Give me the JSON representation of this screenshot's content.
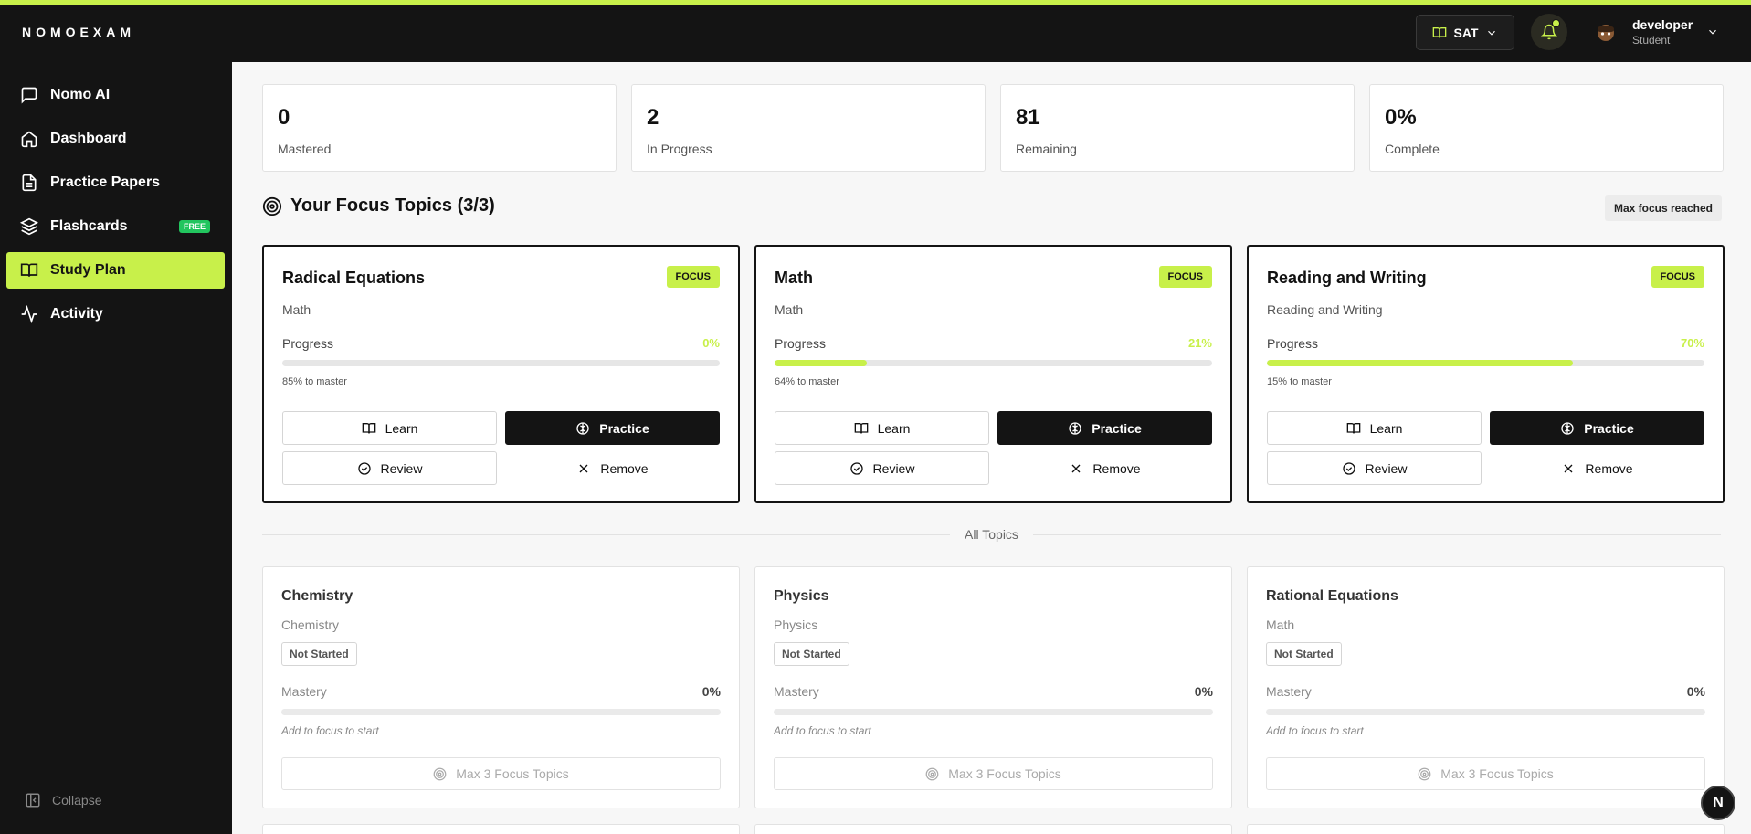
{
  "app": {
    "logo": "NOMOEXAM"
  },
  "header": {
    "exam": "SAT",
    "user": {
      "name": "developer",
      "role": "Student"
    }
  },
  "sidebar": {
    "items": [
      {
        "label": "Nomo AI",
        "icon": "chat-icon"
      },
      {
        "label": "Dashboard",
        "icon": "home-icon"
      },
      {
        "label": "Practice Papers",
        "icon": "document-icon"
      },
      {
        "label": "Flashcards",
        "icon": "layers-icon",
        "badge": "FREE"
      },
      {
        "label": "Study Plan",
        "icon": "book-icon",
        "active": true
      },
      {
        "label": "Activity",
        "icon": "activity-icon"
      }
    ],
    "collapse_label": "Collapse"
  },
  "stats": [
    {
      "value": "0",
      "label": "Mastered"
    },
    {
      "value": "2",
      "label": "In Progress"
    },
    {
      "value": "81",
      "label": "Remaining"
    },
    {
      "value": "0%",
      "label": "Complete"
    }
  ],
  "focus": {
    "heading": "Your Focus Topics (3/3)",
    "max_reached": "Max focus reached",
    "badge": "FOCUS",
    "progress_label": "Progress",
    "buttons": {
      "learn": "Learn",
      "practice": "Practice",
      "review": "Review",
      "remove": "Remove"
    },
    "cards": [
      {
        "title": "Radical Equations",
        "subject": "Math",
        "progress": 0,
        "progress_text": "0%",
        "to_master": "85% to master"
      },
      {
        "title": "Math",
        "subject": "Math",
        "progress": 21,
        "progress_text": "21%",
        "to_master": "64% to master"
      },
      {
        "title": "Reading and Writing",
        "subject": "Reading and Writing",
        "progress": 70,
        "progress_text": "70%",
        "to_master": "15% to master"
      }
    ]
  },
  "all_topics": {
    "label": "All Topics",
    "mastery_label": "Mastery",
    "hint": "Add to focus to start",
    "max_button": "Max 3 Focus Topics",
    "cards": [
      {
        "title": "Chemistry",
        "subject": "Chemistry",
        "status": "Not Started",
        "mastery": 0,
        "mastery_text": "0%"
      },
      {
        "title": "Physics",
        "subject": "Physics",
        "status": "Not Started",
        "mastery": 0,
        "mastery_text": "0%"
      },
      {
        "title": "Rational Equations",
        "subject": "Math",
        "status": "Not Started",
        "mastery": 0,
        "mastery_text": "0%"
      }
    ]
  },
  "dev_badge": "N",
  "colors": {
    "accent": "#c8f04a",
    "dark": "#141414",
    "free_badge": "#22c55e"
  }
}
